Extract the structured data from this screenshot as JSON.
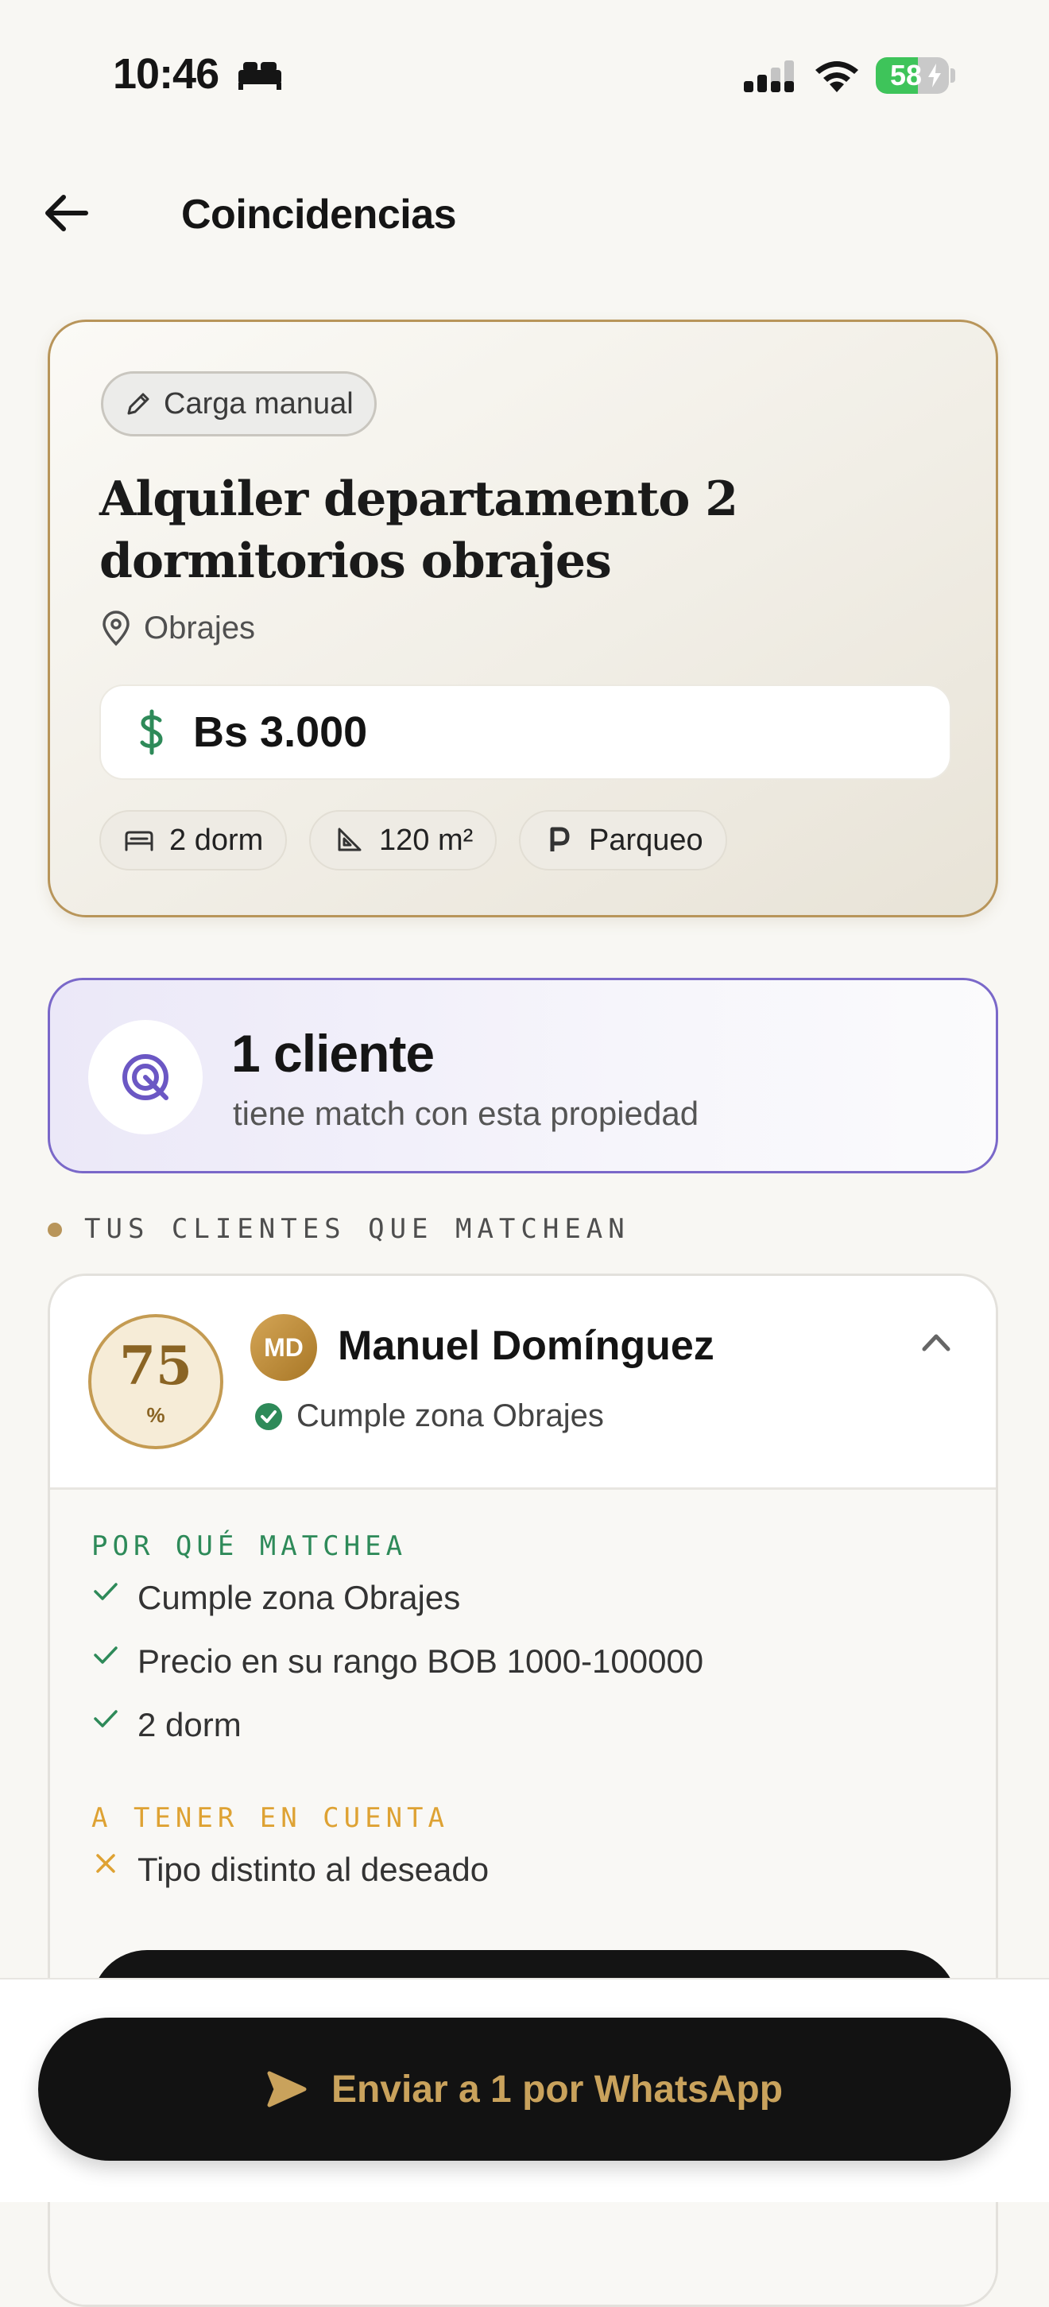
{
  "status_bar": {
    "time": "10:46",
    "battery": "58",
    "battery_level": 0.58
  },
  "header": {
    "title": "Coincidencias"
  },
  "property": {
    "badge": "Carga manual",
    "title": "Alquiler departamento 2 dormitorios obrajes",
    "location": "Obrajes",
    "price": "Bs 3.000",
    "chips": [
      "2 dorm",
      "120 m²",
      "Parqueo"
    ]
  },
  "match_summary": {
    "count": "1 cliente",
    "subtitle": "tiene match con esta propiedad"
  },
  "section_label": "TUS CLIENTES QUE MATCHEAN",
  "client": {
    "score": "75",
    "score_unit": "%",
    "initials": "MD",
    "name": "Manuel Domínguez",
    "zone": "Cumple zona Obrajes",
    "why_label": "POR QUÉ MATCHEA",
    "reasons": [
      "Cumple zona Obrajes",
      "Precio en su rango BOB 1000-100000",
      "2 dorm"
    ],
    "warn_label": "A TENER EN CUENTA",
    "warnings": [
      "Tipo distinto al deseado"
    ]
  },
  "cta": {
    "label": "Enviar a 1 por WhatsApp"
  },
  "colors": {
    "gold": "#b8955a",
    "purple": "#7a68c9",
    "green": "#2e8a59",
    "warning": "#dea233",
    "dark": "#121212"
  }
}
